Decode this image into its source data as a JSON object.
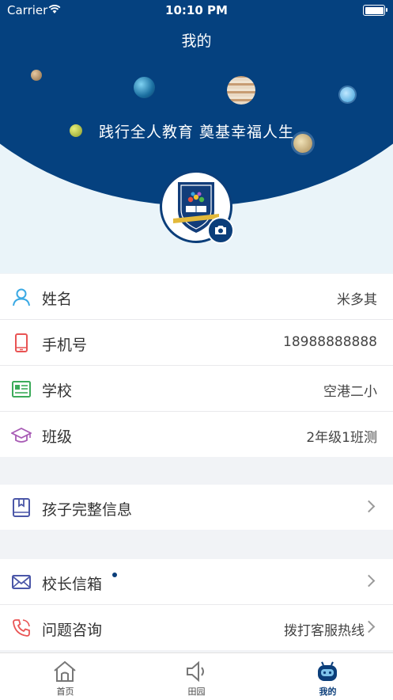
{
  "status_bar": {
    "carrier": "Carrier",
    "time": "10:10 PM"
  },
  "header": {
    "title": "我的",
    "slogan": "践行全人教育 奠基幸福人生"
  },
  "profile_rows": [
    {
      "label": "姓名",
      "value": "米多其",
      "icon": "person-icon"
    },
    {
      "label": "手机号",
      "value": "18988888888",
      "icon": "phone-icon"
    },
    {
      "label": "学校",
      "value": "空港二小",
      "icon": "newspaper-icon"
    },
    {
      "label": "班级",
      "value": "2年级1班测",
      "icon": "graduation-cap-icon"
    }
  ],
  "child_info": {
    "label": "孩子完整信息",
    "icon": "bookmark-book-icon"
  },
  "service_rows": [
    {
      "label": "校长信箱",
      "icon": "mail-icon"
    },
    {
      "label": "问题咨询",
      "value": "拨打客服热线",
      "icon": "phone-call-icon"
    }
  ],
  "tabs": [
    {
      "label": "首页",
      "icon": "home-icon"
    },
    {
      "label": "田园",
      "icon": "speaker-icon"
    },
    {
      "label": "我的",
      "icon": "robot-icon",
      "active": true
    }
  ],
  "colors": {
    "brand": "#05417f",
    "header_bg_light": "#eaf4f9",
    "page_bg": "#f1f3f6"
  }
}
